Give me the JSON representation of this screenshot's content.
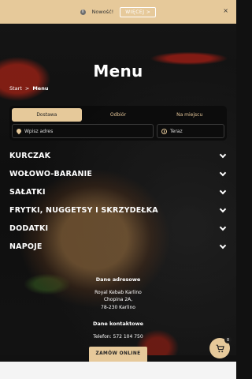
{
  "announcement": {
    "icon": "info-icon",
    "text": "Nowość!",
    "button_label": "WIĘCEJ >",
    "close_label": "×"
  },
  "page": {
    "title": "Menu"
  },
  "breadcrumb": {
    "home": "Start",
    "separator": ">",
    "current": "Menu"
  },
  "order_panel": {
    "tabs": [
      {
        "label": "Dostawa",
        "active": true
      },
      {
        "label": "Odbiór",
        "active": false
      },
      {
        "label": "Na miejscu",
        "active": false
      }
    ],
    "address_placeholder": "Wpisz adres",
    "time_value": "Teraz"
  },
  "categories": [
    {
      "label": "KURCZAK"
    },
    {
      "label": "WOŁOWO-BARANIE"
    },
    {
      "label": "SAŁATKI"
    },
    {
      "label": "FRYTKI, NUGGETSY I SKRZYDEŁKA"
    },
    {
      "label": "DODATKI"
    },
    {
      "label": "NAPOJE"
    }
  ],
  "contact": {
    "address_heading": "Dane adresowe",
    "restaurant_name": "Royal Kebab Karlino",
    "street": "Chopina 2A,",
    "city": "78-230 Karlino",
    "contact_heading": "Dane kontaktowe",
    "phone": "Telefon: 572 104 750",
    "order_button": "ZAMÓW ONLINE"
  },
  "cart": {
    "count": "0"
  },
  "colors": {
    "accent": "#e6c99a",
    "background": "#111111"
  }
}
